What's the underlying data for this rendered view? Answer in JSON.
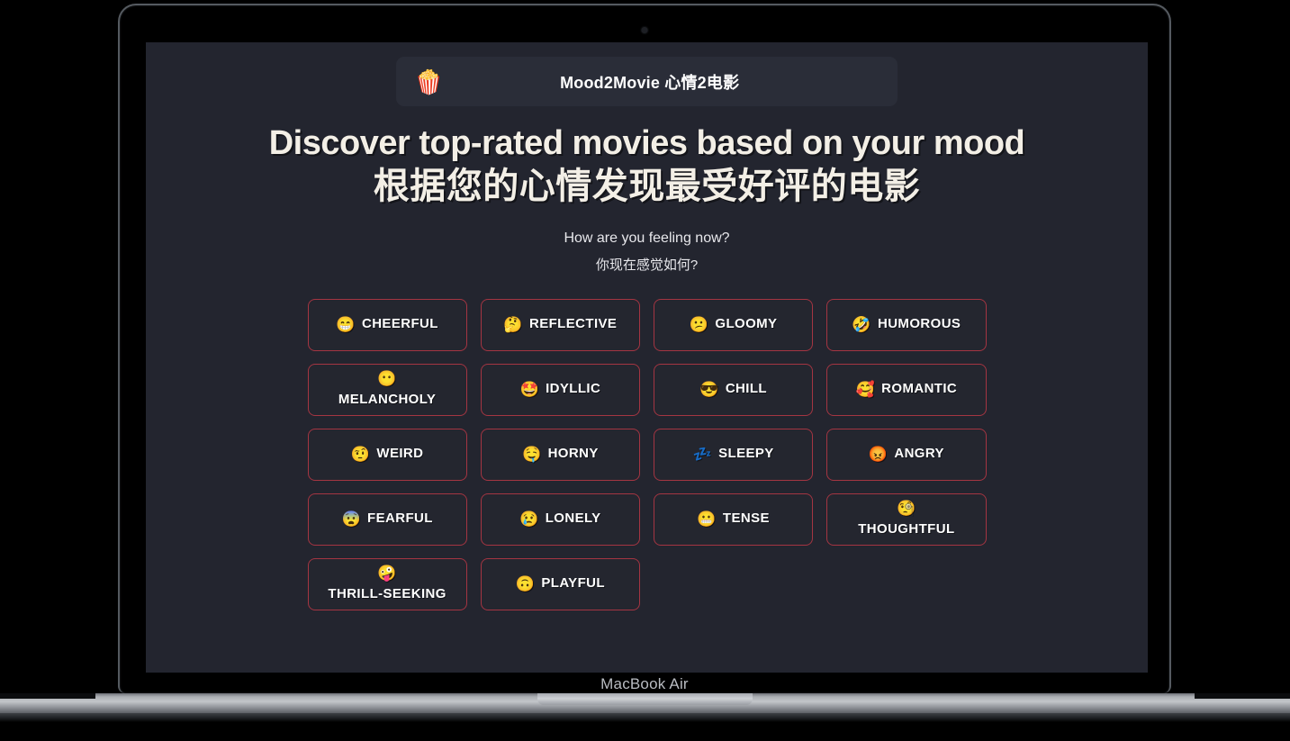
{
  "device": {
    "model_label": "MacBook Air"
  },
  "header": {
    "icon": "popcorn-icon",
    "icon_glyph": "🍿",
    "title": "Mood2Movie 心情2电影"
  },
  "hero": {
    "title_en": "Discover top-rated movies based on your mood",
    "title_zh": "根据您的心情发现最受好评的电影"
  },
  "prompt": {
    "question_en": "How are you feeling now?",
    "question_zh": "你现在感觉如何?"
  },
  "colors": {
    "page_background": "#23252f",
    "header_background": "#2a2d38",
    "button_border": "#a43542",
    "button_background": "#24262f",
    "text_primary": "#ffffff",
    "hero_text": "#f3efe6",
    "outer_background": "#000000",
    "bezel": "#000000",
    "base_silver": "#c3c6ca"
  },
  "moods": [
    {
      "label": "CHEERFUL",
      "emoji": "😁",
      "icon": "grinning-face-icon",
      "wrap": false
    },
    {
      "label": "REFLECTIVE",
      "emoji": "🤔",
      "icon": "thinking-face-icon",
      "wrap": false
    },
    {
      "label": "GLOOMY",
      "emoji": "😕",
      "icon": "confused-face-icon",
      "wrap": false
    },
    {
      "label": "HUMOROUS",
      "emoji": "🤣",
      "icon": "rolling-on-floor-laughing-icon",
      "wrap": false
    },
    {
      "label": "MELANCHOLY",
      "emoji": "😶",
      "icon": "face-without-mouth-icon",
      "wrap": true
    },
    {
      "label": "IDYLLIC",
      "emoji": "🤩",
      "icon": "star-struck-face-icon",
      "wrap": false
    },
    {
      "label": "CHILL",
      "emoji": "😎",
      "icon": "sunglasses-face-icon",
      "wrap": false
    },
    {
      "label": "ROMANTIC",
      "emoji": "🥰",
      "icon": "smiling-face-with-hearts-icon",
      "wrap": false
    },
    {
      "label": "WEIRD",
      "emoji": "🤨",
      "icon": "raised-eyebrow-face-icon",
      "wrap": false
    },
    {
      "label": "HORNY",
      "emoji": "🤤",
      "icon": "drooling-face-icon",
      "wrap": false
    },
    {
      "label": "SLEEPY",
      "emoji": "💤",
      "icon": "sleepy-face-icon",
      "wrap": false
    },
    {
      "label": "ANGRY",
      "emoji": "😡",
      "icon": "angry-face-icon",
      "wrap": false
    },
    {
      "label": "FEARFUL",
      "emoji": "😨",
      "icon": "fearful-face-icon",
      "wrap": false
    },
    {
      "label": "LONELY",
      "emoji": "😢",
      "icon": "crying-face-icon",
      "wrap": false
    },
    {
      "label": "TENSE",
      "emoji": "😬",
      "icon": "grimacing-face-icon",
      "wrap": false
    },
    {
      "label": "THOUGHTFUL",
      "emoji": "🧐",
      "icon": "monocle-face-icon",
      "wrap": true
    },
    {
      "label": "THRILL-SEEKING",
      "emoji": "🤪",
      "icon": "zany-face-icon",
      "wrap": true
    },
    {
      "label": "PLAYFUL",
      "emoji": "🙃",
      "icon": "upside-down-face-icon",
      "wrap": false
    }
  ]
}
